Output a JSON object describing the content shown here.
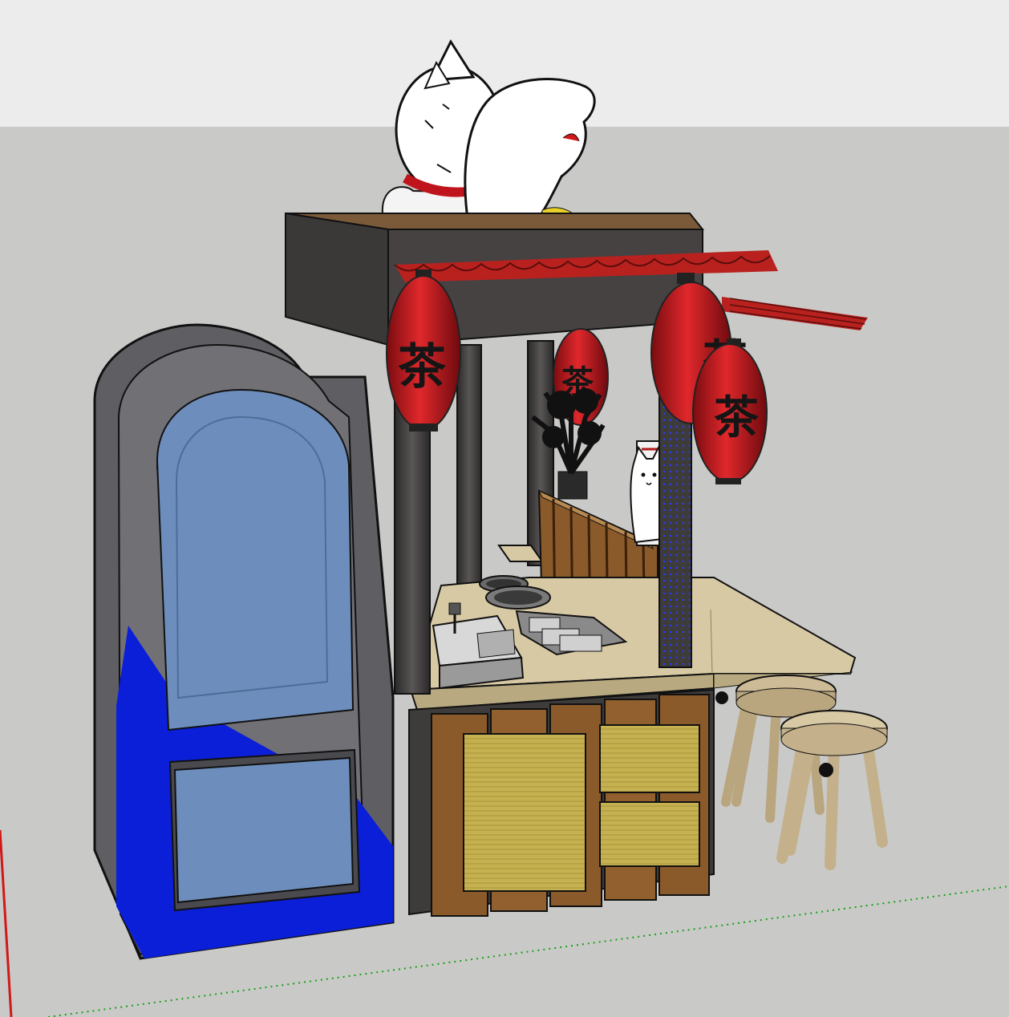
{
  "scene": {
    "sky_color": "#ececec",
    "ground_color": "#c9c9c7",
    "axis_green": "#19a019",
    "axis_red": "#d01818"
  },
  "lanterns": {
    "glyph": "茶",
    "color": "#c8141c",
    "glyph_color": "#151515"
  },
  "colors": {
    "kiosk_dark": "#3e3b3b",
    "roof_tile": "#b8211e",
    "counter_top": "#d8c9a5",
    "wood": "#8a5a2a",
    "rattan": "#c6b150",
    "fridge_blue": "#0b1fd8",
    "fridge_glass": "#6d8ebc",
    "stool_wood": "#cdbb97"
  }
}
